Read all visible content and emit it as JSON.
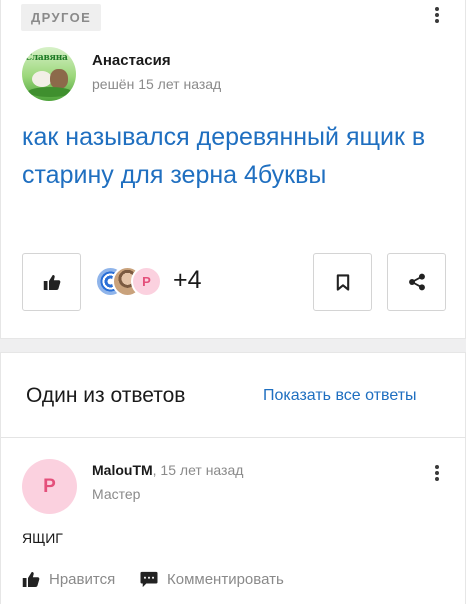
{
  "question": {
    "category": "ДРУГОЕ",
    "author_name": "Анастасия",
    "author_status": "решён 15 лет назад",
    "avatar_text": "Славяна",
    "title": "как назывался деревянный ящик в старину для зерна 4буквы",
    "likers_avatar_letter": "P",
    "likers_more": "+4"
  },
  "answers": {
    "heading": "Один из ответов",
    "show_all": "Показать все ответы",
    "items": [
      {
        "avatar_letter": "P",
        "author_nick": "MalouTM",
        "time": ", 15 лет назад",
        "rank": "Мастер",
        "text": "ЯЩИГ",
        "like_label": "Нравится",
        "comment_label": "Комментировать"
      }
    ]
  },
  "icons": {
    "like": "thumbs-up-icon",
    "bookmark": "bookmark-icon",
    "share": "share-icon",
    "menu": "more-vertical-icon",
    "comment": "comment-icon"
  },
  "colors": {
    "link": "#1f6fc0",
    "muted": "#8a8a8a",
    "avatar_pink": "#fbd1df",
    "avatar_pink_text": "#e4507b"
  }
}
